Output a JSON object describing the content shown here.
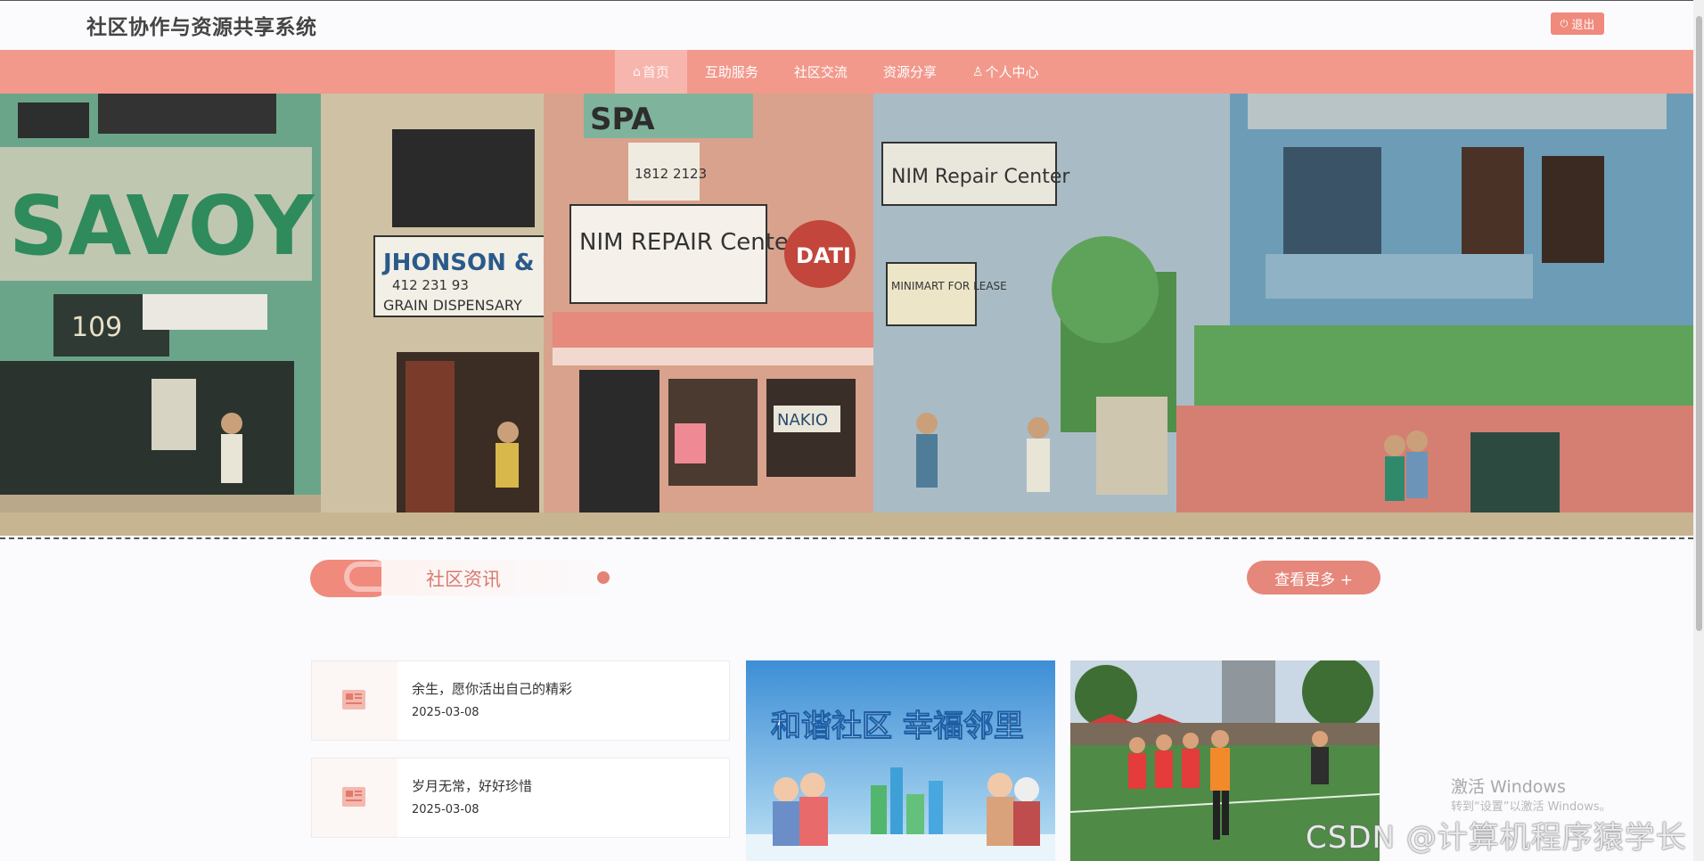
{
  "header": {
    "site_title": "社区协作与资源共享系统",
    "logout_label": "退出",
    "logout_icon": "power-icon"
  },
  "nav": {
    "items": [
      {
        "label": "首页",
        "icon": "home-icon",
        "active": true
      },
      {
        "label": "互助服务"
      },
      {
        "label": "社区交流"
      },
      {
        "label": "资源分享"
      },
      {
        "label": "个人中心",
        "icon": "user-icon"
      }
    ]
  },
  "banner": {
    "signs": [
      "SAVOY",
      "JHONSON & CO.",
      "412 231 93",
      "GRAIN DISPENSARY",
      "SPA",
      "NIM REPAIR Center",
      "NIM Repair Center",
      "MINIMART FOR LEASE",
      "DATI",
      "NAKIO",
      "109",
      "1812 2123"
    ]
  },
  "section": {
    "title": "社区资讯",
    "more_label": "查看更多 +"
  },
  "news": [
    {
      "title": "余生，愿你活出自己的精彩",
      "date": "2025-03-08"
    },
    {
      "title": "岁月无常，好好珍惜",
      "date": "2025-03-08"
    }
  ],
  "photos": [
    {
      "caption": "和谐社区 幸福邻里"
    },
    {
      "caption": ""
    }
  ],
  "watermarks": {
    "windows_title": "激活 Windows",
    "windows_sub": "转到“设置”以激活 Windows。",
    "csdn": "CSDN @计算机程序猿学长"
  },
  "colors": {
    "accent": "#f2998c",
    "button": "#ef8a7c",
    "heading": "#d77b70"
  }
}
